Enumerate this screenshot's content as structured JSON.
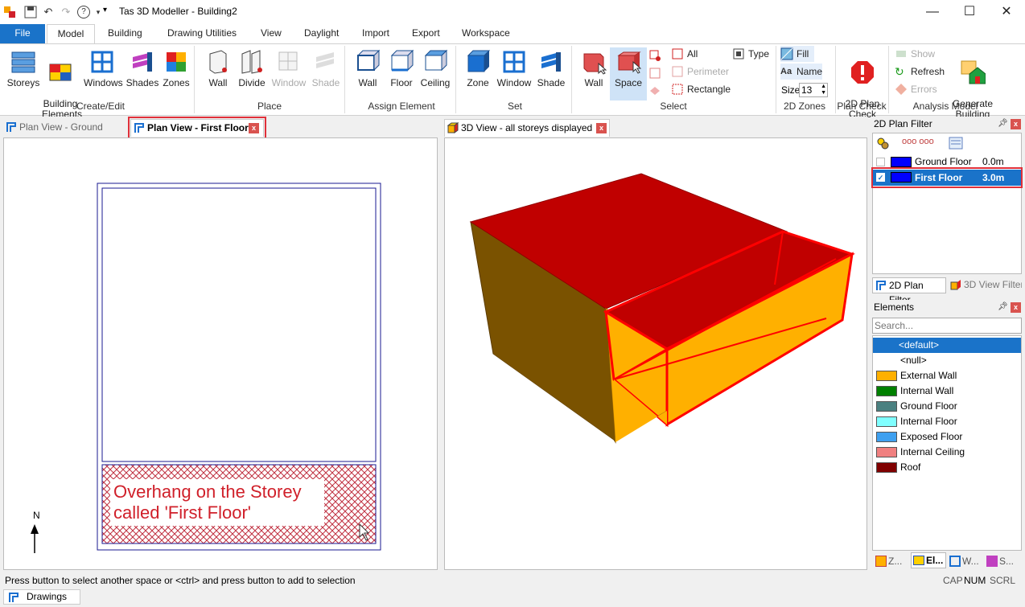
{
  "window": {
    "title": "Tas 3D Modeller - Building2",
    "help_icon": "?",
    "qat_dropdown": "▾",
    "minimize": "—",
    "maximize": "☐",
    "close": "✕"
  },
  "ribbon_tabs": [
    "File",
    "Model",
    "Building",
    "Drawing Utilities",
    "View",
    "Daylight",
    "Import",
    "Export",
    "Workspace"
  ],
  "ribbon": {
    "create_edit": {
      "label": "Create/Edit",
      "buttons": [
        "Storeys",
        "Building\nElements",
        "Windows",
        "Shades",
        "Zones"
      ]
    },
    "place": {
      "label": "Place",
      "buttons": [
        "Wall",
        "Divide",
        "Window",
        "Shade"
      ]
    },
    "assign_element": {
      "label": "Assign Element",
      "buttons": [
        "Wall",
        "Floor",
        "Ceiling"
      ]
    },
    "set": {
      "label": "Set",
      "buttons": [
        "Zone",
        "Window",
        "Shade"
      ]
    },
    "select": {
      "label": "Select",
      "buttons": [
        "Wall",
        "Space"
      ],
      "small": [
        "All",
        "Perimeter",
        "Rectangle",
        "Type"
      ]
    },
    "zones_2d": {
      "label": "2D Zones",
      "fill": "Fill",
      "name": "Name",
      "size_label": "Size",
      "size_value": "13",
      "name_icon_text": "Aa"
    },
    "plan_check": {
      "label": "Plan Check",
      "button": "2D Plan\nCheck"
    },
    "analysis_model": {
      "label": "Analysis Model",
      "small": [
        "Show",
        "Refresh",
        "Errors"
      ],
      "button": "Generate\nBuilding"
    }
  },
  "plan_panel": {
    "tabs": [
      "Plan View - Ground Floor",
      "Plan View - First Floor"
    ],
    "annotation_line1": "Overhang on the Storey",
    "annotation_line2": "called 'First Floor'",
    "north_label": "N"
  },
  "view3d_panel": {
    "tab": "3D View - all storeys displayed",
    "colors": {
      "roof": "#c00000",
      "wall_dark": "#7a5200",
      "wall_light": "#ffb000",
      "highlight": "#ff0000"
    }
  },
  "plan_filter": {
    "title": "2D Plan Filter",
    "storeys": [
      {
        "name": "Ground Floor",
        "height": "0.0m",
        "checked": false
      },
      {
        "name": "First Floor",
        "height": "3.0m",
        "checked": true
      }
    ],
    "tabs": [
      "2D Plan Filter",
      "3D View Filter"
    ]
  },
  "elements": {
    "title": "Elements",
    "search_placeholder": "Search...",
    "items": [
      {
        "label": "<default>",
        "color": null,
        "selected": true
      },
      {
        "label": "<null>",
        "color": null
      },
      {
        "label": "External Wall",
        "color": "#ffb000"
      },
      {
        "label": "Internal Wall",
        "color": "#008000"
      },
      {
        "label": "Ground Floor",
        "color": "#4a8080"
      },
      {
        "label": "Internal Floor",
        "color": "#80ffff"
      },
      {
        "label": "Exposed Floor",
        "color": "#3ea0f0"
      },
      {
        "label": "Internal Ceiling",
        "color": "#f08080"
      },
      {
        "label": "Roof",
        "color": "#800000"
      }
    ],
    "bottom_tabs": [
      "Z...",
      "El...",
      "W...",
      "S..."
    ]
  },
  "status": {
    "message": "Press button to select another space or <ctrl> and press button to add to selection",
    "indicators": [
      "CAP",
      "NUM",
      "SCRL"
    ]
  },
  "taskbar": {
    "item": "Drawings"
  }
}
